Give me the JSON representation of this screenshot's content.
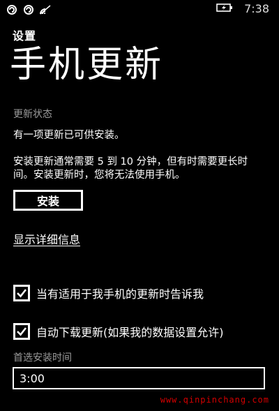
{
  "status_bar": {
    "time": "7:38",
    "icons": [
      "sync-icon",
      "sync-icon",
      "wifi-icon",
      "battery-charging-icon"
    ]
  },
  "app_title": "设置",
  "page_title": "手机更新",
  "update_status": {
    "label": "更新状态",
    "message": "有一项更新已可供安装。",
    "description_line1": "安装更新通常需要 5 到 10 分钟，但有时需要更长时",
    "description_line2": "间。安装更新时，您将无法使用手机。"
  },
  "install_button_label": "安装",
  "show_details_link": "显示详细信息",
  "options": {
    "notify_label": "当有适用于我手机的更新时告诉我",
    "notify_checked": true,
    "auto_download_label": "自动下载更新(如果我的数据设置允许)",
    "auto_download_checked": true
  },
  "preferred_install_time": {
    "label": "首选安装时间",
    "value": "3:00"
  },
  "watermark": "www.qinpinchang.com",
  "colors": {
    "background": "#000000",
    "foreground": "#ffffff",
    "secondary_text": "#9b9b9b",
    "watermark": "#d40000"
  }
}
